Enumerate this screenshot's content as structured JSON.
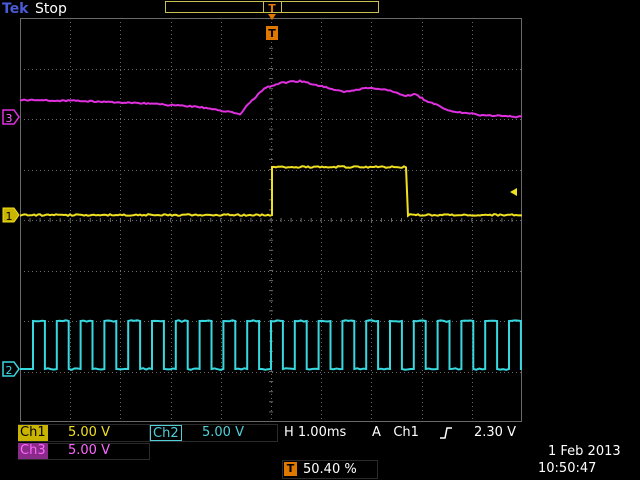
{
  "header": {
    "brand": "Tek",
    "run_state": "Stop"
  },
  "markers": {
    "trigger_marker": "T",
    "ch1_marker": "1",
    "ch2_marker": "2",
    "ch3_marker": "3"
  },
  "readouts": {
    "ch1_label": "Ch1",
    "ch1_scale": "5.00 V",
    "ch2_label": "Ch2",
    "ch2_scale": "5.00 V",
    "ch3_label": "Ch3",
    "ch3_scale": "5.00 V",
    "timebase": "H 1.00ms",
    "trigger_mode": "A",
    "trigger_source": "Ch1",
    "trigger_level": "2.30 V",
    "trigger_position_icon": "T",
    "trigger_position": "50.40 %",
    "date": "1 Feb  2013",
    "time": "10:50:47"
  },
  "colors": {
    "ch1": "#f0e020",
    "ch2": "#38d8e0",
    "ch3": "#e030e0",
    "graticule": "#6a6a6a",
    "trigger": "#e07800"
  },
  "icons": {
    "trigger_edge": "rising-edge-icon",
    "trigger_level_arrow": "left-arrow-icon"
  }
}
